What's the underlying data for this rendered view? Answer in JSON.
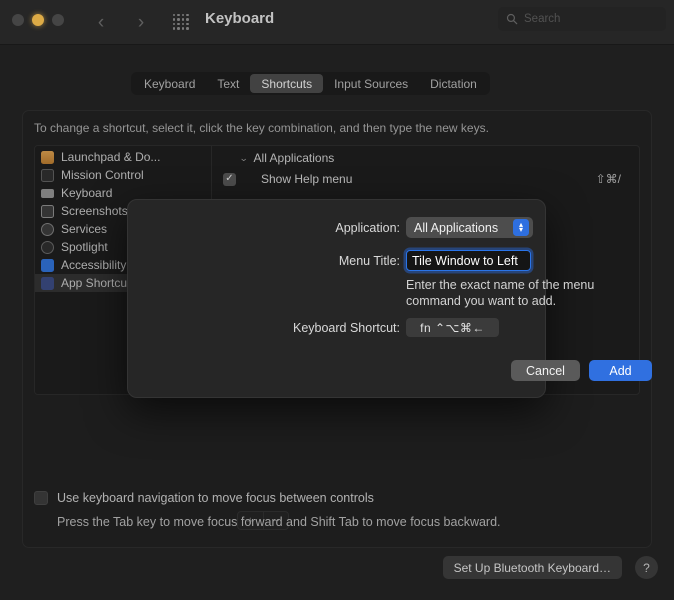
{
  "window": {
    "title": "Keyboard",
    "traffic_lights": [
      "close",
      "minimize",
      "zoom"
    ],
    "nav_back": "‹",
    "nav_forward": "›",
    "grid_icon": "grid-icon"
  },
  "search": {
    "value": "",
    "placeholder": "Search",
    "icon": "search-icon"
  },
  "tabs": [
    {
      "label": "Keyboard",
      "selected": false
    },
    {
      "label": "Text",
      "selected": false
    },
    {
      "label": "Shortcuts",
      "selected": true
    },
    {
      "label": "Input Sources",
      "selected": false
    },
    {
      "label": "Dictation",
      "selected": false
    }
  ],
  "main": {
    "hint": "To change a shortcut, select it, click the key combination, and then type the new keys.",
    "sidebar": [
      {
        "label": "Launchpad & Do...",
        "icon": "launchpad-icon",
        "color": "#c98a3c",
        "selected": false
      },
      {
        "label": "Mission Control",
        "icon": "mission-control-icon",
        "color": "#3d3d3d",
        "selected": false
      },
      {
        "label": "Keyboard",
        "icon": "keyboard-icon",
        "color": "#9a9a9a",
        "selected": false
      },
      {
        "label": "Screenshots",
        "icon": "screenshots-icon",
        "color": "#4a4a4a",
        "selected": false
      },
      {
        "label": "Services",
        "icon": "services-icon",
        "color": "#4a4a4a",
        "selected": false
      },
      {
        "label": "Spotlight",
        "icon": "spotlight-icon",
        "color": "#3a3a3a",
        "selected": false
      },
      {
        "label": "Accessibility",
        "icon": "accessibility-icon",
        "color": "#2f6fd0",
        "selected": false
      },
      {
        "label": "App Shortcuts",
        "icon": "app-shortcuts-icon",
        "color": "#3a4f8a",
        "selected": true
      }
    ],
    "group": {
      "label": "All Applications",
      "expanded": true,
      "chevron": "⌄"
    },
    "shortcut_rows": [
      {
        "label": "Show Help menu",
        "keys": "⇧⌘/",
        "checked": true,
        "check_glyph": "✓"
      }
    ],
    "list_buttons": {
      "add": "+",
      "remove": "−"
    },
    "nav_checkbox": {
      "label": "Use keyboard navigation to move focus between controls",
      "checked": false,
      "sublabel": "Press the Tab key to move focus forward and Shift Tab to move focus backward."
    }
  },
  "footer": {
    "bluetooth_button": "Set Up Bluetooth Keyboard…",
    "help_button": "?"
  },
  "sheet": {
    "application_label": "Application:",
    "application_value": "All Applications",
    "menu_title_label": "Menu Title:",
    "menu_title_value": "Tile Window to Left",
    "menu_title_help": "Enter the exact name of the menu command you want to add.",
    "shortcut_label": "Keyboard Shortcut:",
    "shortcut_value": "fn ⌃⌥⌘←",
    "cancel_button": "Cancel",
    "add_button": "Add"
  },
  "colors": {
    "accent_blue": "#3070e0",
    "window_bg": "#232323",
    "titlebar_bg": "#2b2b2b",
    "sheet_bg": "#262626",
    "selected_tab": "#4a4a4a"
  }
}
